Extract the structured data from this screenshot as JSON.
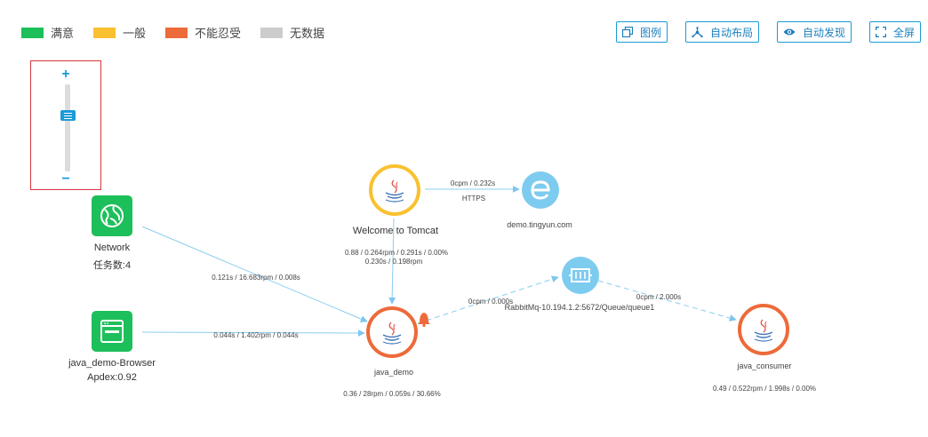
{
  "legend": [
    {
      "label": "满意",
      "color": "#1dbf5a"
    },
    {
      "label": "一般",
      "color": "#f9c130"
    },
    {
      "label": "不能忍受",
      "color": "#ed6a3a"
    },
    {
      "label": "无数据",
      "color": "#cccccc"
    }
  ],
  "toolbar": {
    "legend_label": "图例",
    "auto_layout_label": "自动布局",
    "auto_discover_label": "自动发现",
    "fullscreen_label": "全屏"
  },
  "zoom": {
    "plus": "+",
    "minus": "−",
    "level": 0.3
  },
  "nodes": {
    "network": {
      "name": "Network",
      "sub": "任务数:4",
      "icon": "globe-icon",
      "color": "#1dbf5a"
    },
    "browser": {
      "name": "java_demo-Browser",
      "sub": "Apdex:0.92",
      "icon": "browser-window-icon",
      "color": "#1dbf5a"
    },
    "tomcat": {
      "name": "Welcome to Tomcat",
      "stats1": "0.88 / 0.264rpm / 0.291s / 0.00%",
      "stats2": "0.230s / 0.198rpm",
      "icon": "java-icon",
      "color": "#f9c130"
    },
    "tingyun": {
      "name": "demo.tingyun.com",
      "icon": "external-service-icon",
      "color": "#7ecbf0"
    },
    "java_demo": {
      "name": "java_demo",
      "stats": "0.36 / 28rpm / 0.059s / 30.66%",
      "icon": "java-icon",
      "color": "#ed6a3a"
    },
    "rabbitmq": {
      "name": "RabbitMq-10.194.1.2:5672/Queue/queue1",
      "icon": "message-queue-icon",
      "color": "#7ecbf0"
    },
    "consumer": {
      "name": "java_consumer",
      "stats": "0.49 / 0.522rpm / 1.998s / 0.00%",
      "icon": "java-icon",
      "color": "#ed6a3a"
    }
  },
  "edges": {
    "network_java_demo": "0.121s / 16.683rpm / 0.008s",
    "browser_java_demo": "0.044s / 1.402rpm / 0.044s",
    "tomcat_tingyun": "0cpm / 0.232s",
    "tomcat_tingyun_protocol": "HTTPS",
    "java_demo_rabbitmq": "0cpm / 0.000s",
    "rabbitmq_consumer": "0cpm / 2.000s"
  },
  "alert_icon": "bell-icon"
}
